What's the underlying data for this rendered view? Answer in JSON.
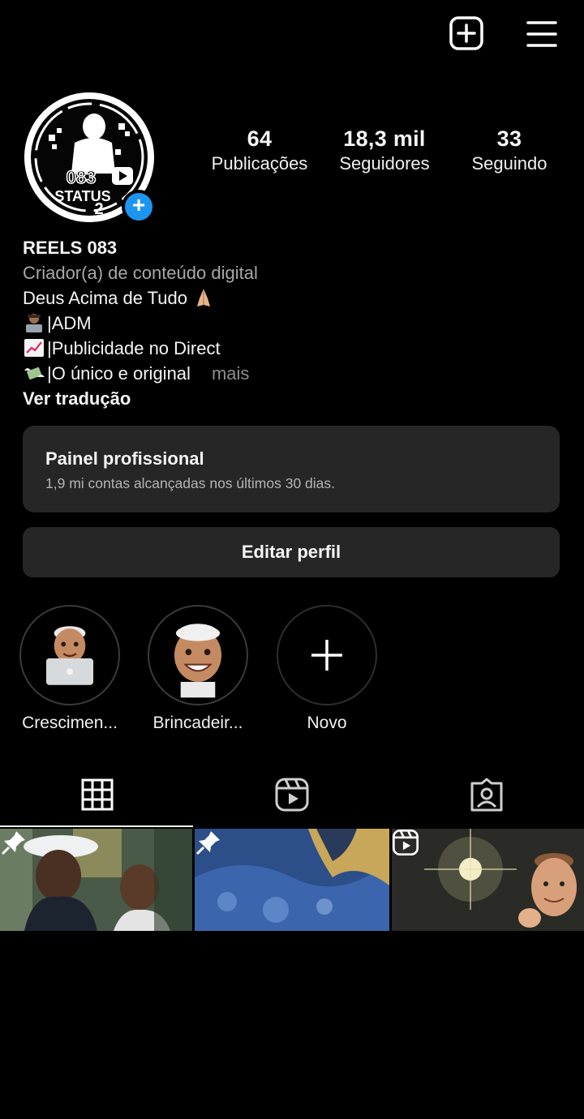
{
  "header": {
    "create_icon": "plus-square-icon",
    "menu_icon": "hamburger-menu-icon"
  },
  "profile": {
    "avatar_text": "083 STATUS 2",
    "stats": [
      {
        "value": "64",
        "label": "Publicações"
      },
      {
        "value": "18,3 mil",
        "label": "Seguidores"
      },
      {
        "value": "33",
        "label": "Seguindo"
      }
    ],
    "name": "REELS 083",
    "category": "Criador(a) de conteúdo digital",
    "bio_lines": [
      "Deus Acima de Tudo",
      "|ADM",
      "|Publicidade no Direct",
      "|O único e original"
    ],
    "more_label": "mais",
    "translate_label": "Ver tradução"
  },
  "dashboard": {
    "title": "Painel profissional",
    "subtitle": "1,9 mi contas alcançadas nos últimos 30 dias."
  },
  "edit_profile_label": "Editar perfil",
  "highlights": [
    {
      "label": "Crescimen...",
      "icon": "memoji-laptop-icon"
    },
    {
      "label": "Brincadeir...",
      "icon": "memoji-face-icon"
    },
    {
      "label": "Novo",
      "icon": "plus-icon"
    }
  ],
  "tabs": [
    {
      "name": "grid",
      "icon": "grid-icon",
      "active": true
    },
    {
      "name": "reels",
      "icon": "reels-icon",
      "active": false
    },
    {
      "name": "tagged",
      "icon": "tagged-person-icon",
      "active": false
    }
  ],
  "posts": [
    {
      "badge": "pin-icon"
    },
    {
      "badge": "pin-icon"
    },
    {
      "badge": "reels-icon"
    }
  ],
  "colors": {
    "background": "#000000",
    "surface": "#262626",
    "accent": "#1d95f0",
    "secondary_text": "#a8a8a8"
  }
}
